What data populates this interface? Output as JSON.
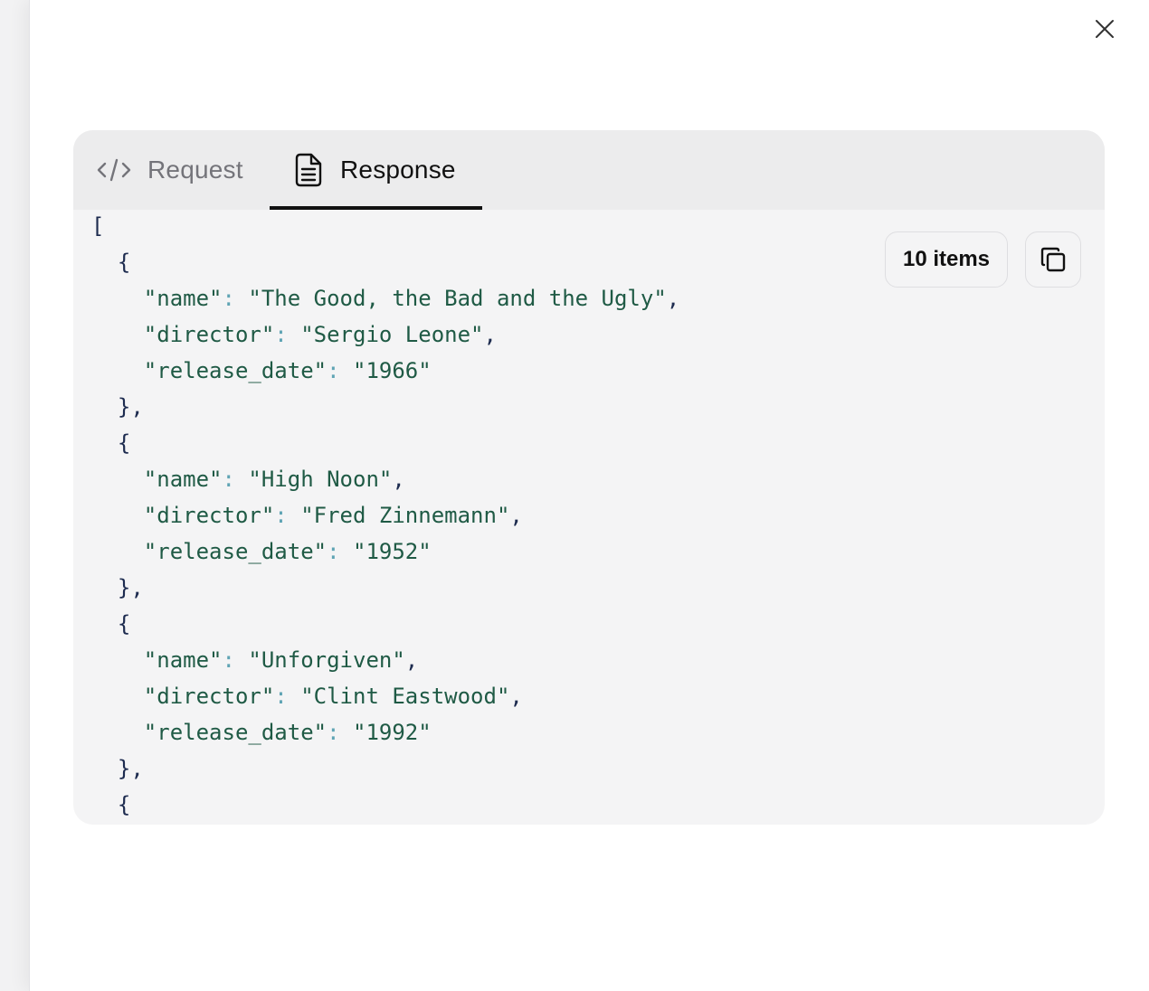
{
  "modal": {
    "close_icon": "close-icon"
  },
  "tabs": [
    {
      "label": "Request",
      "icon": "code-icon",
      "active": false
    },
    {
      "label": "Response",
      "icon": "document-icon",
      "active": true
    }
  ],
  "response": {
    "items_badge": "10 items",
    "copy_icon": "copy-icon",
    "open_bracket": "[",
    "records": [
      {
        "name": "The Good, the Bad and the Ugly",
        "director": "Sergio Leone",
        "release_date": "1966"
      },
      {
        "name": "High Noon",
        "director": "Fred Zinnemann",
        "release_date": "1952"
      },
      {
        "name": "Unforgiven",
        "director": "Clint Eastwood",
        "release_date": "1992"
      }
    ],
    "keys": {
      "name": "name",
      "director": "director",
      "release_date": "release_date"
    },
    "trailing_open_brace": "{"
  },
  "colors": {
    "json_key": "#1f5a45",
    "json_string": "#1f5a45",
    "json_colon": "#5fa4b4",
    "json_punctuation": "#1d2b4f",
    "active_tab_underline": "#111111"
  }
}
